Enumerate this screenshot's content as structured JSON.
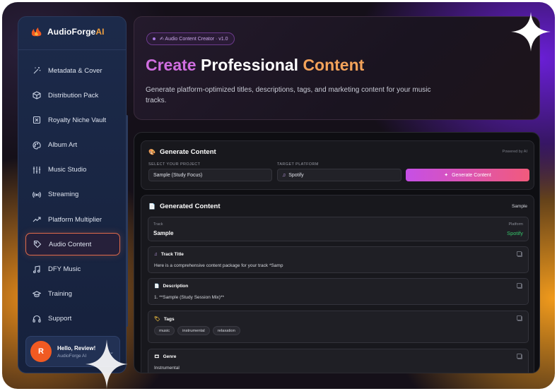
{
  "brand": {
    "name": "AudioForge",
    "suffix": "AI"
  },
  "sidebar": {
    "items": [
      {
        "label": "Metadata & Cover",
        "icon": "wand-icon"
      },
      {
        "label": "Distribution Pack",
        "icon": "package-icon"
      },
      {
        "label": "Royalty Niche Vault",
        "icon": "vault-icon"
      },
      {
        "label": "Album Art",
        "icon": "palette-icon"
      },
      {
        "label": "Music Studio",
        "icon": "sliders-icon"
      },
      {
        "label": "Streaming",
        "icon": "broadcast-icon"
      },
      {
        "label": "Platform Multiplier",
        "icon": "trend-icon"
      },
      {
        "label": "Audio Content",
        "icon": "tag-icon",
        "active": true
      },
      {
        "label": "DFY Music",
        "icon": "music-note-icon"
      },
      {
        "label": "Training",
        "icon": "graduation-cap-icon"
      },
      {
        "label": "Support",
        "icon": "headphones-icon"
      }
    ]
  },
  "user": {
    "initial": "R",
    "greeting": "Hello, Review!",
    "subtitle": "AudioForge AI"
  },
  "hero": {
    "badge": "✍  Audio Content Creator  ·  v1.0",
    "title_part1": "Create",
    "title_part2": "Professional",
    "title_part3": "Content",
    "description": "Generate platform-optimized titles, descriptions, tags, and marketing content for your music tracks."
  },
  "generate": {
    "title": "Generate Content",
    "powered": "Powered by AI",
    "project_label": "SELECT YOUR PROJECT",
    "project_value": "Sample (Study Focus)",
    "platform_label": "TARGET PLATFORM",
    "platform_value": "Spotify",
    "button": "Generate Content"
  },
  "output": {
    "title": "Generated Content",
    "tag": "Sample",
    "track_label": "Track",
    "track_value": "Sample",
    "platform_label": "Platform",
    "platform_value": "Spotify",
    "sections": {
      "track_title": {
        "title": "Track Title",
        "body": "Here is a comprehensive content package for your track *Samp"
      },
      "description": {
        "title": "Description",
        "body": "1. **Sample (Study Session Mix)**"
      },
      "tags": {
        "title": "Tags",
        "chips": [
          "music",
          "instrumental",
          "relaxation"
        ]
      },
      "genre": {
        "title": "Genre",
        "body": "Instrumental"
      }
    }
  },
  "colors": {
    "accent": "#f15a22",
    "success": "#36c46a",
    "gradient_start": "#c64fe6",
    "gradient_end": "#f25a7c"
  }
}
